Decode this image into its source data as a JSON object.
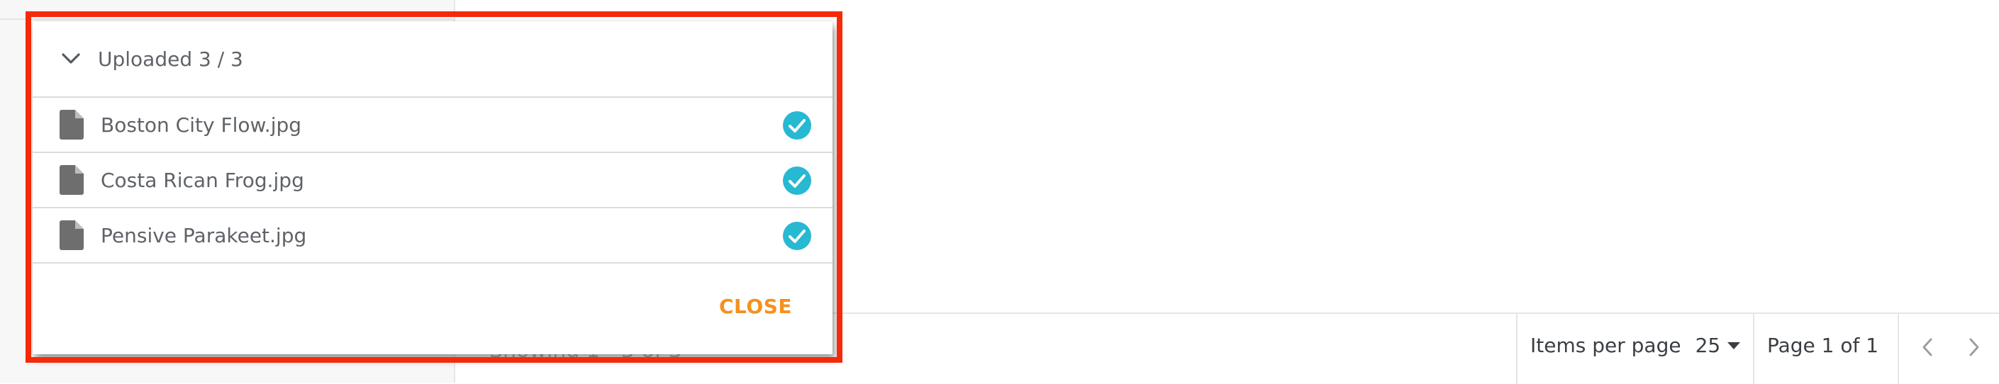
{
  "colors": {
    "check": "#27b8d2",
    "close_accent": "#f5911e",
    "highlight": "#f52a0a",
    "file_icon": "#6e6e6e"
  },
  "upload_dialog": {
    "header_icon": "chevron-down-icon",
    "title": "Uploaded 3 / 3",
    "files": [
      {
        "name": "Boston City Flow.jpg",
        "status_icon": "check-circle-icon"
      },
      {
        "name": "Costa Rican Frog.jpg",
        "status_icon": "check-circle-icon"
      },
      {
        "name": "Pensive Parakeet.jpg",
        "status_icon": "check-circle-icon"
      }
    ],
    "close_label": "CLOSE"
  },
  "footer": {
    "showing": "Showing 1 - 3 of 3",
    "items_per_page_label": "Items per page",
    "items_per_page_value": "25",
    "page_text": "Page 1 of 1",
    "prev_icon": "chevron-left-icon",
    "next_icon": "chevron-right-icon"
  }
}
